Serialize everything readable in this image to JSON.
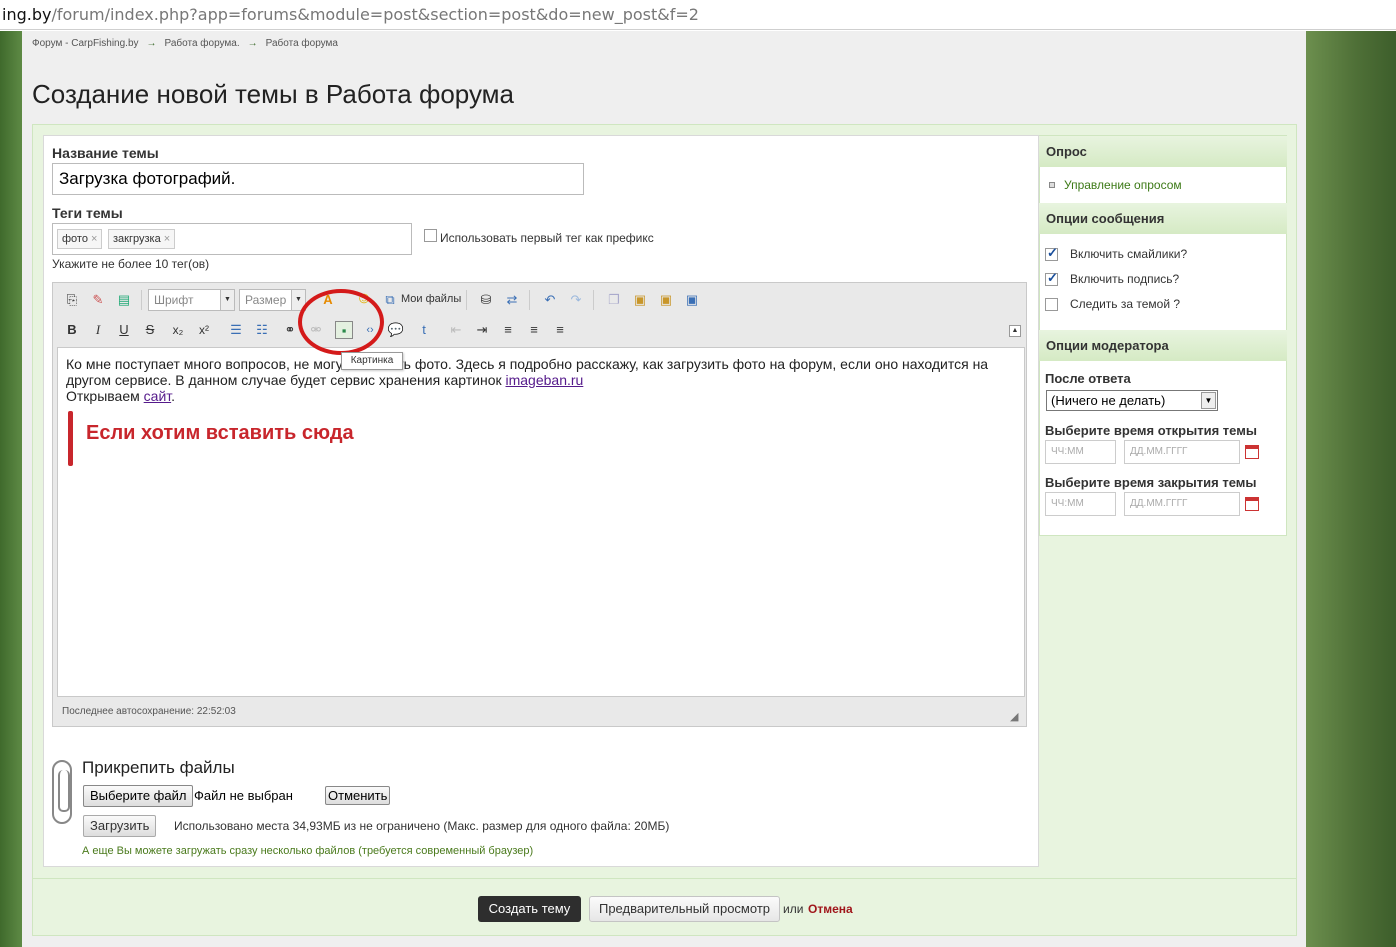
{
  "url": {
    "host": "ing.by",
    "path": "/forum/index.php?app=forums&module=post&section=post&do=new_post&f=2"
  },
  "breadcrumb": [
    "Форум - CarpFishing.by",
    "Работа форума.",
    "Работа форума"
  ],
  "page_title": "Создание новой темы в Работа форума",
  "topic": {
    "label": "Название темы",
    "value": "Загрузка фотографий."
  },
  "tags": {
    "label": "Теги темы",
    "items": [
      "фото",
      "закгрузка"
    ],
    "remove_glyph": "×",
    "prefix_label": "Использовать первый тег как префикс",
    "hint": "Укажите не более 10 тег(ов)"
  },
  "toolbar": {
    "font_placeholder": "Шрифт",
    "size_placeholder": "Размер",
    "my_files": "Мои файлы",
    "tooltip": "Картинка"
  },
  "editor": {
    "line1": "Ко мне поступает много вопросов, не могу выложить фото. Здесь я подробно расскажу, как загрузить фото на форум, если оно находится на другом сервисе. В данном случае будет сервис хранения картинок ",
    "link1": "imageban.ru",
    "line2_prefix": "Открываем ",
    "link2": "сайт",
    "line2_suffix": ".",
    "annotation": "Если хотим вставить сюда",
    "autosave": "Последнее автосохранение: 22:52:03"
  },
  "attachments": {
    "title": "Прикрепить файлы",
    "choose": "Выберите файл",
    "no_file": "Файл не выбран",
    "cancel": "Отменить",
    "upload": "Загрузить",
    "usage": "Использовано места 34,93МБ из не ограничено (Макс. размер для одного файла: 20МБ)",
    "hint": "А еще Вы можете загружать сразу несколько файлов (требуется современный браузер)"
  },
  "sidebar": {
    "poll_header": "Опрос",
    "poll_link": "Управление опросом",
    "options_header": "Опции сообщения",
    "options": [
      {
        "label": "Включить смайлики?",
        "checked": true
      },
      {
        "label": "Включить подпись?",
        "checked": true
      },
      {
        "label": "Следить за темой ?",
        "checked": false
      }
    ],
    "moderator_header": "Опции модератора",
    "after_reply_label": "После ответа",
    "after_reply_value": "(Ничего не делать)",
    "open_time_label": "Выберите время открытия темы",
    "close_time_label": "Выберите время закрытия темы",
    "time_placeholder": "ЧЧ:ММ",
    "date_placeholder": "ДД.ММ.ГГГГ"
  },
  "footer": {
    "submit": "Создать тему",
    "preview": "Предварительный просмотр",
    "or": "или",
    "cancel": "Отмена"
  }
}
